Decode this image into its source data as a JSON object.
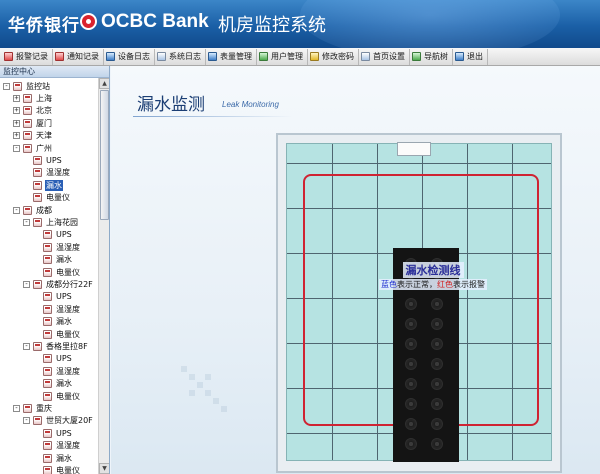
{
  "header": {
    "brand_cn": "华侨银行",
    "brand_en": "OCBC Bank",
    "system_title": "机房监控系统"
  },
  "toolbar": {
    "items": [
      {
        "label": "报警记录",
        "icon": "alarm-icon"
      },
      {
        "label": "通知记录",
        "icon": "notice-icon"
      },
      {
        "label": "设备日志",
        "icon": "device-log-icon"
      },
      {
        "label": "系统日志",
        "icon": "system-log-icon"
      },
      {
        "label": "表量管理",
        "icon": "meter-icon"
      },
      {
        "label": "用户管理",
        "icon": "user-icon"
      },
      {
        "label": "修改密码",
        "icon": "key-icon"
      },
      {
        "label": "首页设置",
        "icon": "home-settings-icon"
      },
      {
        "label": "导航树",
        "icon": "nav-tree-icon"
      },
      {
        "label": "退出",
        "icon": "exit-icon"
      }
    ]
  },
  "sidebar": {
    "header": "监控中心",
    "tree": [
      {
        "label": "监控站",
        "pm": "−",
        "level": 0
      },
      {
        "label": "上海",
        "pm": "+",
        "level": 1
      },
      {
        "label": "北京",
        "pm": "+",
        "level": 1
      },
      {
        "label": "厦门",
        "pm": "+",
        "level": 1
      },
      {
        "label": "天津",
        "pm": "+",
        "level": 1
      },
      {
        "label": "广州",
        "pm": "−",
        "level": 1
      },
      {
        "label": "UPS",
        "pm": "",
        "level": 2
      },
      {
        "label": "温湿度",
        "pm": "",
        "level": 2
      },
      {
        "label": "漏水",
        "pm": "",
        "level": 2,
        "selected": true
      },
      {
        "label": "电量仪",
        "pm": "",
        "level": 2
      },
      {
        "label": "成都",
        "pm": "−",
        "level": 1
      },
      {
        "label": "上海花园",
        "pm": "−",
        "level": 2
      },
      {
        "label": "UPS",
        "pm": "",
        "level": 3
      },
      {
        "label": "温湿度",
        "pm": "",
        "level": 3
      },
      {
        "label": "漏水",
        "pm": "",
        "level": 3
      },
      {
        "label": "电量仪",
        "pm": "",
        "level": 3
      },
      {
        "label": "成都分行22F",
        "pm": "−",
        "level": 2
      },
      {
        "label": "UPS",
        "pm": "",
        "level": 3
      },
      {
        "label": "温湿度",
        "pm": "",
        "level": 3
      },
      {
        "label": "漏水",
        "pm": "",
        "level": 3
      },
      {
        "label": "电量仪",
        "pm": "",
        "level": 3
      },
      {
        "label": "香格里拉8F",
        "pm": "−",
        "level": 2
      },
      {
        "label": "UPS",
        "pm": "",
        "level": 3
      },
      {
        "label": "温湿度",
        "pm": "",
        "level": 3
      },
      {
        "label": "漏水",
        "pm": "",
        "level": 3
      },
      {
        "label": "电量仪",
        "pm": "",
        "level": 3
      },
      {
        "label": "重庆",
        "pm": "−",
        "level": 1
      },
      {
        "label": "世贸大厦20F",
        "pm": "−",
        "level": 2
      },
      {
        "label": "UPS",
        "pm": "",
        "level": 3
      },
      {
        "label": "温湿度",
        "pm": "",
        "level": 3
      },
      {
        "label": "漏水",
        "pm": "",
        "level": 3
      },
      {
        "label": "电量仪",
        "pm": "",
        "level": 3
      }
    ]
  },
  "main": {
    "title": "漏水监测",
    "title_en": "Leak Monitoring",
    "legend_title": "漏水检测线",
    "legend_blue": "蓝色",
    "legend_mid": "表示正常，",
    "legend_red": "红色",
    "legend_end": "表示报警"
  },
  "colors": {
    "banner": "#1a5fa6",
    "leak_line": "#cf2332",
    "floor": "#b6e3e2",
    "selected": "#2a5fb5"
  }
}
